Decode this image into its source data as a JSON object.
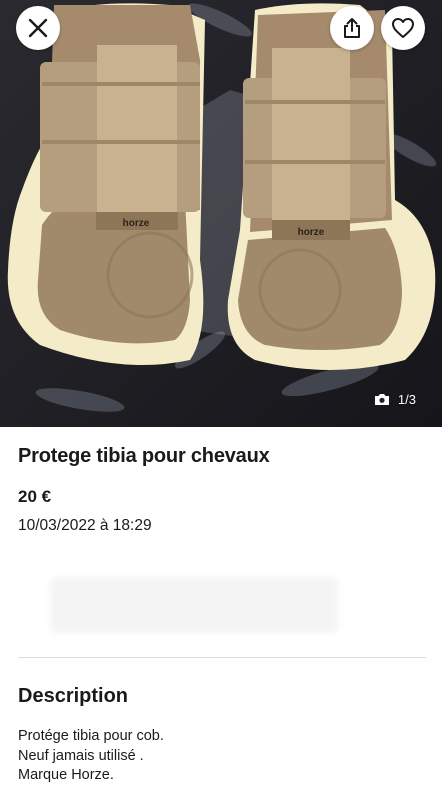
{
  "header": {
    "close_icon": "close-icon",
    "share_icon": "share-icon",
    "favorite_icon": "heart-icon"
  },
  "gallery": {
    "counter": "1/3",
    "camera_icon": "camera-icon",
    "brand_left": "horze",
    "brand_right": "horze"
  },
  "listing": {
    "title": "Protege tibia pour chevaux",
    "price": "20 €",
    "date": "10/03/2022 à 18:29"
  },
  "description": {
    "heading": "Description",
    "lines": [
      "Protége tibia pour cob.",
      "Neuf jamais utilisé .",
      "Marque Horze."
    ]
  }
}
